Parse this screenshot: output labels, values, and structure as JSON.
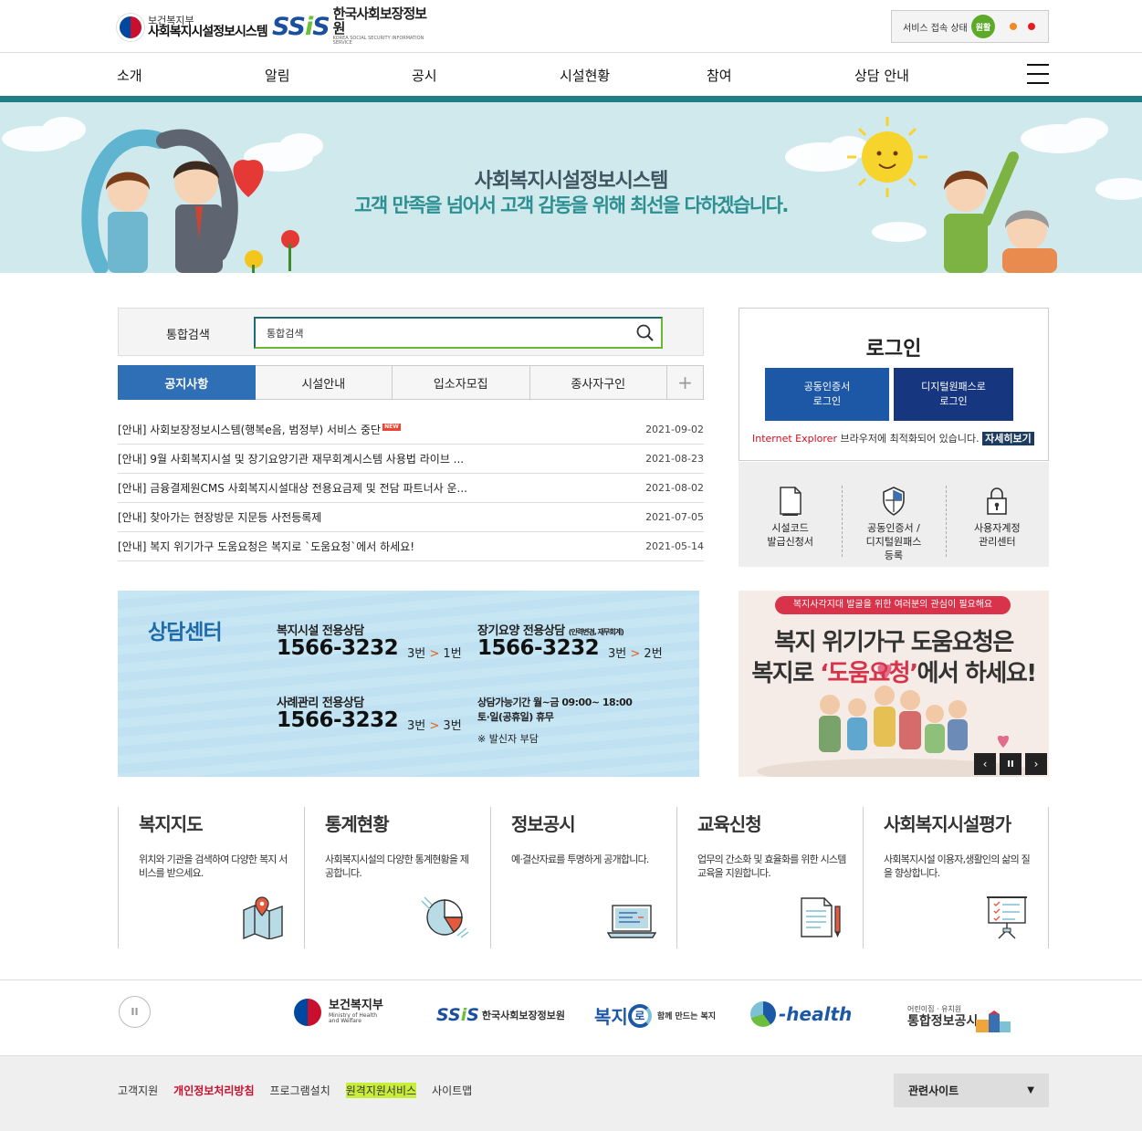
{
  "header": {
    "mohw_small": "보건복지부",
    "mohw_big": "사회복지시설정보시스템",
    "ssis_ss": "SS",
    "ssis_i": "i",
    "ssis_s": "S",
    "ssis_name": "한국사회보장정보원",
    "ssis_en": "KOREA SOCIAL SECURITY INFORMATION SERVICE",
    "status_label": "서비스 접속 상태",
    "status_value": "원활"
  },
  "gnb": [
    "소개",
    "알림",
    "공시",
    "시설현황",
    "참여",
    "상담 안내"
  ],
  "banner": {
    "title": "사회복지시설정보시스템",
    "subtitle": "고객 만족을 넘어서 고객 감동을 위해 최선을 다하겠습니다."
  },
  "search": {
    "label": "통합검색",
    "value": "통합검색"
  },
  "tabs": [
    "공지사항",
    "시설안내",
    "입소자모집",
    "종사자구인"
  ],
  "tab_plus": "+",
  "notices": [
    {
      "title": "[안내] 사회보장정보시스템(행복e음, 범정부) 서비스 중단",
      "date": "2021-09-02",
      "badge": "NEW"
    },
    {
      "title": "[안내] 9월 사회복지시설 및 장기요양기관 재무회계시스템 사용법 라이브 ...",
      "date": "2021-08-23"
    },
    {
      "title": "[안내] 금융결제원CMS 사회복지시설대상 전용요금제 및 전담 파트너사 운...",
      "date": "2021-08-02"
    },
    {
      "title": "[안내] 찾아가는 현장방문 지문등 사전등록제",
      "date": "2021-07-05"
    },
    {
      "title": "[안내] 복지 위기가구 도움요청은 복지로 `도움요청`에서 하세요!",
      "date": "2021-05-14"
    }
  ],
  "login": {
    "title": "로그인",
    "btn_cert_1": "공동인증서",
    "btn_cert_2": "로그인",
    "btn_digital_1": "디지털원패스로",
    "btn_digital_2": "로그인",
    "ie_red": "Internet Explorer",
    "ie_text": " 브라우저에 최적화되어 있습니다. ",
    "ie_more": "자세히보기"
  },
  "quick": [
    {
      "line1": "시설코드",
      "line2": "발급신청서",
      "line3": "",
      "icon": "document-icon"
    },
    {
      "line1": "공동인증서 /",
      "line2": "디지털원패스",
      "line3": "등록",
      "icon": "shield-icon"
    },
    {
      "line1": "사용자계정",
      "line2": "관리센터",
      "line3": "",
      "icon": "lock-icon"
    }
  ],
  "counsel": {
    "title": "상담센터",
    "welfare_label": "복지시설 전용상담",
    "welfare_num": "1566-3232",
    "welfare_ext_a": "3번",
    "welfare_ext_b": "1번",
    "ltc_label": "장기요양 전용상담",
    "ltc_small": "(인력변경, 재무회계)",
    "ltc_num": "1566-3232",
    "ltc_ext_a": "3번",
    "ltc_ext_b": "2번",
    "case_label": "사례관리 전용상담",
    "case_num": "1566-3232",
    "case_ext_a": "3번",
    "case_ext_b": "3번",
    "gt": ">",
    "hours_1": "상담가능기간 월~금 09:00~ 18:00",
    "hours_2": "토·일(공휴일) 휴무",
    "note": "※ 발신자 부담"
  },
  "promo": {
    "pill": "복지사각지대 발굴을 위한 여러분의 관심이 필요해요",
    "line1": "복지 위기가구 도움요청은",
    "line2_a": "복지로 ",
    "line2_hl": "‘도움요청’",
    "line2_b": "에서 하세요!",
    "prev": "‹",
    "pause": "II",
    "next": "›"
  },
  "cards": [
    {
      "title": "복지지도",
      "desc": "위치와 기관을 검색하여 다양한 복지 서비스를 받으세요.",
      "icon": "map-icon"
    },
    {
      "title": "통계현황",
      "desc": "사회복지시설의 다양한 통계현황을 제공합니다.",
      "icon": "pie-chart-icon"
    },
    {
      "title": "정보공시",
      "desc": "예·결산자료를 투명하게 공개합니다.",
      "icon": "laptop-icon"
    },
    {
      "title": "교육신청",
      "desc": "업무의 간소화 및 효율화를 위한 시스템 교육을 지원합니다.",
      "icon": "document-pen-icon"
    },
    {
      "title": "사회복지시설평가",
      "desc": "사회복지시설 이용자,생활인의 삶의 질을 향상합니다.",
      "icon": "presentation-board-icon"
    }
  ],
  "partners": {
    "pause": "II",
    "mohw_ko": "보건복지부",
    "mohw_en1": "Ministry of Health",
    "mohw_en2": "and Welfare",
    "ssis_ss": "SS",
    "ssis_i": "i",
    "ssis_s": "S",
    "ssis_name": "한국사회보장정보원",
    "bokjiro_a": "복지",
    "bokjiro_b": "로",
    "bokjiro_sub": "함께 만드는 복지",
    "ehealth": "-health",
    "childcare_small": "어린이집 · 유치원",
    "childcare_big": "통합정보공시"
  },
  "footer": {
    "links": [
      "고객지원",
      "개인정보처리방침",
      "프로그램설치",
      "원격지원서비스",
      "사이트맵"
    ],
    "related": "관련사이트",
    "related_arrow": "▼"
  },
  "colors": {
    "teal": "#1f7e86",
    "tab_active": "#2f6fb5",
    "login_cert": "#1d58a7",
    "login_digital": "#16367f",
    "accent_red": "#d8334a"
  }
}
